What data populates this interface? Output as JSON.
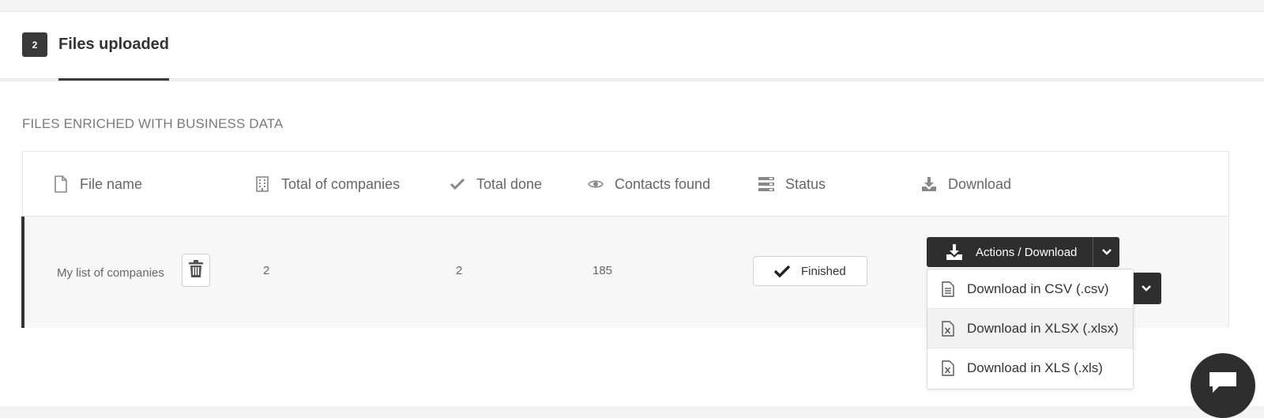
{
  "tab": {
    "count": "2",
    "label": "Files uploaded"
  },
  "section_title": "FILES ENRICHED WITH BUSINESS DATA",
  "table": {
    "columns": [
      {
        "label": "File name",
        "icon": "file-icon"
      },
      {
        "label": "Total of companies",
        "icon": "building-icon"
      },
      {
        "label": "Total done",
        "icon": "check-icon"
      },
      {
        "label": "Contacts found",
        "icon": "eye-icon"
      },
      {
        "label": "Status",
        "icon": "server-icon"
      },
      {
        "label": "Download",
        "icon": "download-icon"
      }
    ],
    "rows": [
      {
        "file_name": "My list of companies",
        "total_companies": "2",
        "total_done": "2",
        "contacts_found": "185",
        "status": "Finished"
      }
    ]
  },
  "actions": {
    "button_label": "Actions / Download",
    "menu": [
      {
        "label": "Download in CSV (.csv)",
        "icon": "csv-file-icon"
      },
      {
        "label": "Download in XLSX (.xlsx)",
        "icon": "excel-file-icon"
      },
      {
        "label": "Download in XLS (.xls)",
        "icon": "excel-file-icon"
      }
    ]
  },
  "colors": {
    "accent_dark": "#2e2e2e",
    "row_bg": "#f7f7f7"
  }
}
